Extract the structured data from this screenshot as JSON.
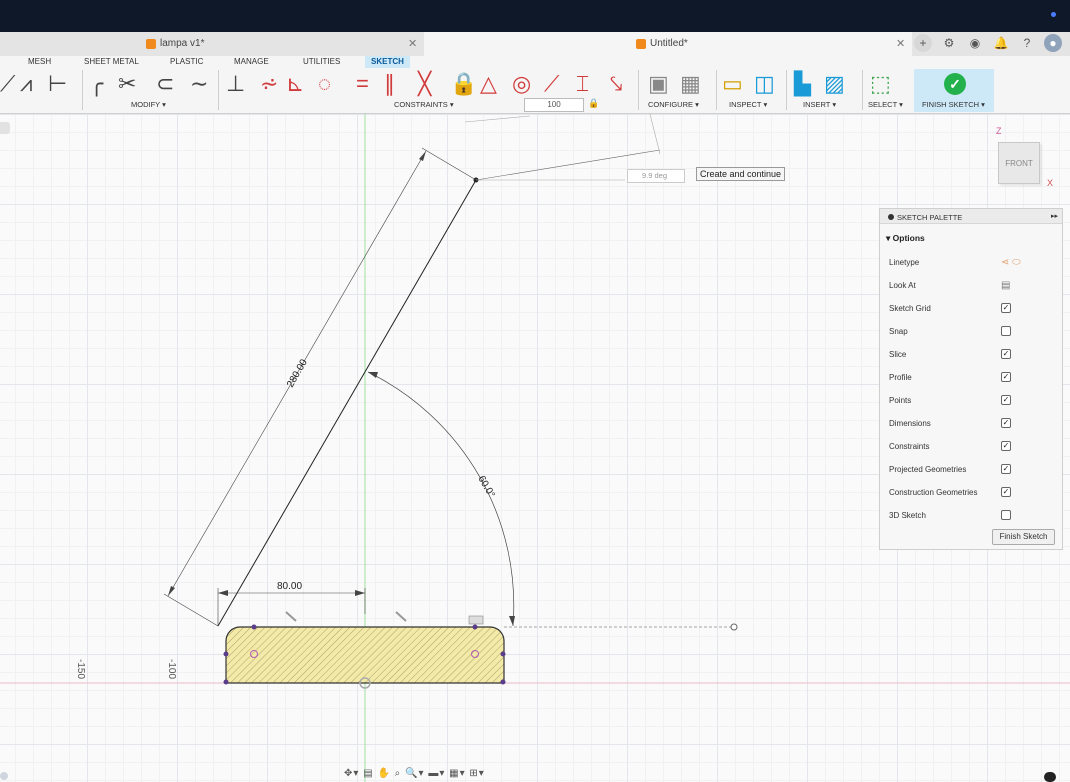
{
  "tabs": [
    {
      "title": "lampa v1*",
      "active": false
    },
    {
      "title": "Untitled*",
      "active": true
    }
  ],
  "ribbon": {
    "tabs": [
      "MESH",
      "SHEET METAL",
      "PLASTIC",
      "MANAGE",
      "UTILITIES",
      "SKETCH"
    ],
    "active_tab": "SKETCH",
    "groups": [
      "MODIFY ▾",
      "CONSTRAINTS ▾",
      "CONFIGURE ▾",
      "INSPECT ▾",
      "INSERT ▾",
      "SELECT ▾",
      "FINISH SKETCH ▾"
    ],
    "value_input": "100"
  },
  "sketch": {
    "dim_length": "280.00",
    "dim_offset": "80.00",
    "dim_angle": "60.0°",
    "angle_input": "9.9 deg",
    "tooltip": "Create and continue",
    "axis_labels": [
      "-150",
      "-100"
    ]
  },
  "viewcube": {
    "face": "FRONT",
    "z": "Z",
    "x": "X"
  },
  "palette": {
    "title": "SKETCH PALETTE",
    "section": "Options",
    "rows": [
      {
        "label": "Linetype",
        "type": "icon",
        "icon": "linetype-icons"
      },
      {
        "label": "Look At",
        "type": "icon",
        "icon": "look-at-icon"
      },
      {
        "label": "Sketch Grid",
        "type": "check",
        "checked": true
      },
      {
        "label": "Snap",
        "type": "check",
        "checked": false
      },
      {
        "label": "Slice",
        "type": "check",
        "checked": true
      },
      {
        "label": "Profile",
        "type": "check",
        "checked": true
      },
      {
        "label": "Points",
        "type": "check",
        "checked": true
      },
      {
        "label": "Dimensions",
        "type": "check",
        "checked": true
      },
      {
        "label": "Constraints",
        "type": "check",
        "checked": true
      },
      {
        "label": "Projected Geometries",
        "type": "check",
        "checked": true
      },
      {
        "label": "Construction Geometries",
        "type": "check",
        "checked": true
      },
      {
        "label": "3D Sketch",
        "type": "check",
        "checked": false
      }
    ],
    "finish_label": "Finish Sketch"
  },
  "colors": {
    "accent": "#cde8f7",
    "profile_fill": "#f3eaa8",
    "finish_green": "#23b14d"
  }
}
